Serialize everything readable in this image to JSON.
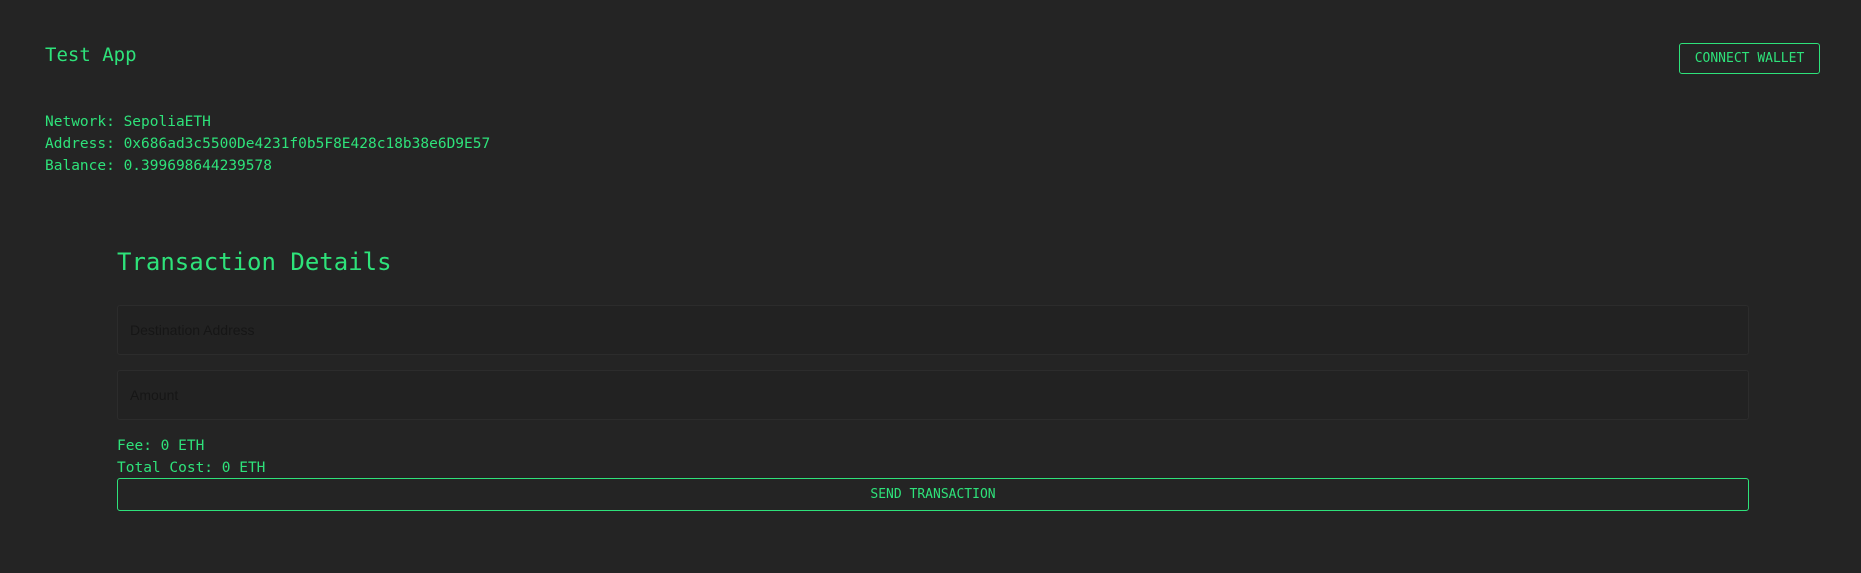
{
  "header": {
    "app_title": "Test App",
    "connect_button": "CONNECT WALLET"
  },
  "wallet": {
    "network": "Network: SepoliaETH",
    "address": "Address: 0x686ad3c5500De4231f0b5F8E428c18b38e6D9E57",
    "balance": "Balance: 0.399698644239578"
  },
  "transaction": {
    "title": "Transaction Details",
    "destination_placeholder": "Destination Address",
    "amount_placeholder": "Amount",
    "fee": "Fee: 0 ETH",
    "total_cost": "Total Cost: 0 ETH",
    "send_button": "SEND TRANSACTION"
  },
  "colors": {
    "background": "#242424",
    "accent": "#2ee27a"
  }
}
